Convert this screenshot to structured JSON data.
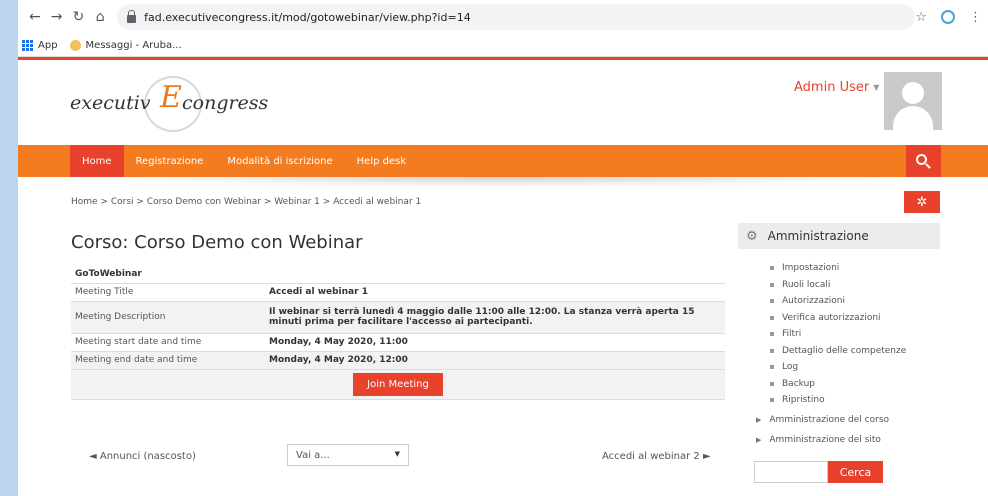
{
  "browser": {
    "url": "fad.executivecongress.it/mod/gotowebinar/view.php?id=14",
    "bookmarks": [
      "App",
      "Messaggi - Aruba..."
    ]
  },
  "header": {
    "logo_prefix": "executiv",
    "logo_letter": "E",
    "logo_suffix": "congress",
    "user_name": "Admin User"
  },
  "nav": {
    "items": [
      "Home",
      "Registrazione",
      "Modalità di iscrizione",
      "Help desk"
    ],
    "active": "Home"
  },
  "breadcrumb": [
    "Home",
    "Corsi",
    "Corso Demo con Webinar",
    "Webinar 1",
    "Accedi al webinar 1"
  ],
  "page_title": "Corso: Corso Demo con Webinar",
  "webinar": {
    "caption": "GoToWebinar",
    "rows": [
      {
        "label": "Meeting Title",
        "value": "Accedi al webinar 1"
      },
      {
        "label": "Meeting Description",
        "value": "Il webinar si terrà lunedì 4 maggio dalle 11:00 alle 12:00. La stanza verrà aperta 15 minuti prima per facilitare l'accesso ai partecipanti."
      },
      {
        "label": "Meeting start date and time",
        "value": "Monday, 4 May 2020, 11:00"
      },
      {
        "label": "Meeting end date and time",
        "value": "Monday, 4 May 2020, 12:00"
      }
    ],
    "join_label": "Join Meeting"
  },
  "pager": {
    "prev": "◄ Annunci (nascosto)",
    "jump_placeholder": "Vai a...",
    "next": "Accedi al webinar 2 ►"
  },
  "admin": {
    "title": "Amministrazione",
    "items": [
      "Impostazioni",
      "Ruoli locali",
      "Autorizzazioni",
      "Verifica autorizzazioni",
      "Filtri",
      "Dettaglio delle competenze",
      "Log",
      "Backup",
      "Ripristino"
    ],
    "sections": [
      "Amministrazione del corso",
      "Amministrazione del sito"
    ],
    "search_label": "Cerca"
  },
  "colors": {
    "accent": "#e8412c",
    "navbar": "#f47c20"
  }
}
